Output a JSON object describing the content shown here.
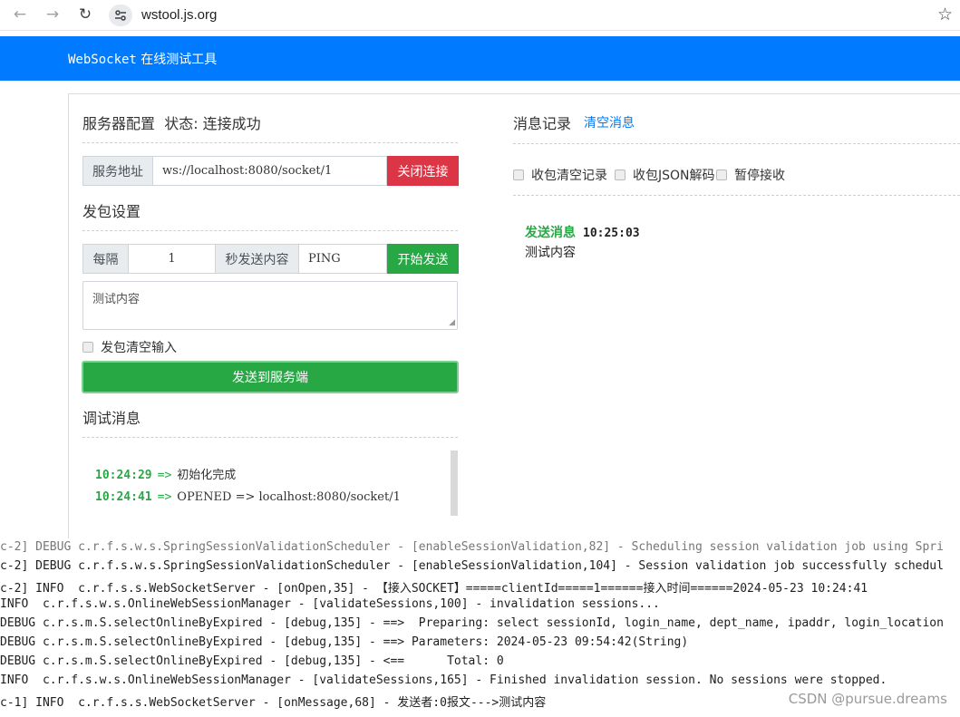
{
  "browser": {
    "url": "wstool.js.org",
    "back_icon": "←",
    "forward_icon": "→",
    "reload_icon": "↻",
    "star_icon": "☆"
  },
  "header": {
    "title_en": "WebSocket",
    "title_cn": " 在线测试工具",
    "color": "#007bff"
  },
  "server": {
    "title": "服务器配置",
    "status": "状态: 连接成功",
    "address_label": "服务地址",
    "address_value": "ws://localhost:8080/socket/1",
    "close_button": "关闭连接"
  },
  "send_settings": {
    "title": "发包设置",
    "interval_label": "每隔",
    "interval_value": "1",
    "content_label": "秒发送内容",
    "content_value": "PING",
    "start_button": "开始发送",
    "textarea_value": "测试内容",
    "clear_input_label": "发包清空输入",
    "send_button": "发送到服务端"
  },
  "debug": {
    "title": "调试消息",
    "logs": [
      {
        "time": "10:24:29",
        "arrow": "=>",
        "msg": "初始化完成"
      },
      {
        "time": "10:24:41",
        "arrow": "=>",
        "msg": "OPENED => localhost:8080/socket/1"
      }
    ]
  },
  "messages": {
    "title": "消息记录",
    "clear_link": "清空消息",
    "options": [
      "收包清空记录",
      "收包JSON解码",
      "暂停接收"
    ],
    "entries": [
      {
        "label": "发送消息",
        "time": "10:25:03",
        "body": "测试内容"
      }
    ]
  },
  "console": {
    "lines": [
      "c-2] DEBUG c.r.f.s.w.s.SpringSessionValidationScheduler - [enableSessionValidation,82] - Scheduling session validation job using Spri",
      "c-2] DEBUG c.r.f.s.w.s.SpringSessionValidationScheduler - [enableSessionValidation,104] - Session validation job successfully schedul",
      "c-2] INFO  c.r.f.s.s.WebSocketServer - [onOpen,35] - 【接入SOCKET】=====clientId=====1======接入时间======2024-05-23 10:24:41",
      "INFO  c.r.f.s.w.s.OnlineWebSessionManager - [validateSessions,100] - invalidation sessions...",
      "DEBUG c.r.s.m.S.selectOnlineByExpired - [debug,135] - ==>  Preparing: select sessionId, login_name, dept_name, ipaddr, login_location",
      "DEBUG c.r.s.m.S.selectOnlineByExpired - [debug,135] - ==> Parameters: 2024-05-23 09:54:42(String)",
      "DEBUG c.r.s.m.S.selectOnlineByExpired - [debug,135] - <==      Total: 0",
      "INFO  c.r.f.s.w.s.OnlineWebSessionManager - [validateSessions,165] - Finished invalidation session. No sessions were stopped.",
      "c-1] INFO  c.r.f.s.s.WebSocketServer - [onMessage,68] - 发送者:0报文--->测试内容"
    ],
    "watermark": "CSDN @pursue.dreams"
  }
}
